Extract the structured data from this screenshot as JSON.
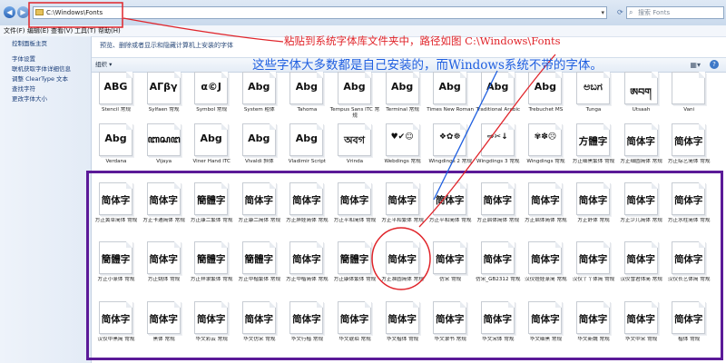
{
  "window": {
    "nav_back_icon": "back-arrow-icon",
    "nav_forward_icon": "forward-arrow-icon",
    "address": "C:\\Windows\\Fonts",
    "search_placeholder": "搜索 Fonts"
  },
  "menu": [
    "文件(F)",
    "编辑(E)",
    "查看(V)",
    "工具(T)",
    "帮助(H)"
  ],
  "sidebar": {
    "home": "控制面板主页",
    "links": [
      "字体设置",
      "联机获取字体详细信息",
      "调整 ClearType 文本",
      "查找字符",
      "更改字体大小"
    ]
  },
  "main": {
    "description": "预览、删除或者显示和隐藏计算机上安装的字体",
    "organize": "组织 ▾"
  },
  "annotations": {
    "red": "粘贴到系统字体库文件夹中，路径如图  C:\\Windows\\Fonts",
    "blue": "这些字体大多数都是自己安装的，而Windows系统不带的字体。",
    "colors": {
      "red": "#e0242a",
      "blue": "#1f5fe0",
      "frame": "#5b1a98"
    }
  },
  "rows": [
    [
      {
        "g": "ABG",
        "l": "Stencil 常规"
      },
      {
        "g": "AΓβγ",
        "l": "Sylfaen 常规"
      },
      {
        "g": "α©J",
        "l": "Symbol 常规"
      },
      {
        "g": "Abg",
        "l": "System 粗体"
      },
      {
        "g": "Abg",
        "l": "Tahoma"
      },
      {
        "g": "Abg",
        "l": "Tempus Sans ITC 常规"
      },
      {
        "g": "Abg",
        "l": "Terminal 常规"
      },
      {
        "g": "Abg",
        "l": "Times New Roman"
      },
      {
        "g": "Abg",
        "l": "Traditional Arabic"
      },
      {
        "g": "Abg",
        "l": "Trebuchet MS"
      },
      {
        "g": "ಅಬಗ",
        "l": "Tunga"
      },
      {
        "g": "ཨབག",
        "l": "Utsaah"
      },
      {
        "g": "",
        "l": "Vani"
      }
    ],
    [
      {
        "g": "Abg",
        "l": "Verdana"
      },
      {
        "g": "ꦧꦱꦔ",
        "l": "Vijaya"
      },
      {
        "g": "Abg",
        "l": "Viner Hand ITC"
      },
      {
        "g": "Abg",
        "l": "Vivaldi 斜体"
      },
      {
        "g": "Abg",
        "l": "Vladimir Script"
      },
      {
        "g": "অবগ",
        "l": "Vrinda"
      },
      {
        "g": "♥✔☺",
        "l": "Webdings 常规"
      },
      {
        "g": "❖✿☸",
        "l": "Wingdings 2 常规"
      },
      {
        "g": "⇨✂↓",
        "l": "Wingdings 3 常规"
      },
      {
        "g": "✾✽☹",
        "l": "Wingdings 常规"
      },
      {
        "g": "方體字",
        "l": "方正细黑繁体 常规"
      },
      {
        "g": "简体字",
        "l": "方正细圆简体 常规"
      },
      {
        "g": "简体字",
        "l": "方正综艺简体 常规"
      }
    ],
    [
      {
        "g": "简体字",
        "l": "方正黄草简体 常规"
      },
      {
        "g": "简体字",
        "l": "方正卡通简体 常规"
      },
      {
        "g": "簡體字",
        "l": "方正康二繁体 常规"
      },
      {
        "g": "简体字",
        "l": "方正康二简体 常规"
      },
      {
        "g": "简体字",
        "l": "方正胖娃简体 常规"
      },
      {
        "g": "简体字",
        "l": "方正平和简体 常规"
      },
      {
        "g": "简体字",
        "l": "方正平和繁体 常规"
      },
      {
        "g": "简体字",
        "l": "方正平和简体 常规"
      },
      {
        "g": "简体字",
        "l": "方正启体简体 常规"
      },
      {
        "g": "简体字",
        "l": "方正启体简体 常规"
      },
      {
        "g": "简体字",
        "l": "方正舒体 常规"
      },
      {
        "g": "简体字",
        "l": "方正少儿简体 常规"
      },
      {
        "g": "简体字",
        "l": "方正水柱简体 常规"
      }
    ],
    [
      {
        "g": "簡體字",
        "l": "方正小篆体 常规"
      },
      {
        "g": "简体字",
        "l": "方正姚体 常规"
      },
      {
        "g": "簡體字",
        "l": "方正祥隶繁体 常规"
      },
      {
        "g": "簡體字",
        "l": "方正中楷繁体 常规"
      },
      {
        "g": "简体字",
        "l": "方正中楷简体 常规"
      },
      {
        "g": "簡體字",
        "l": "方正康体繁体 常规"
      },
      {
        "g": "简体字",
        "l": "方正准圆简体 常规"
      },
      {
        "g": "简体字",
        "l": "仿宋 常规"
      },
      {
        "g": "简体字",
        "l": "仿宋_GB2312 常规"
      },
      {
        "g": "简体字",
        "l": "汉仪娃娃篆简 常规"
      },
      {
        "g": "简体字",
        "l": "汉仪丫丫体简 常规"
      },
      {
        "g": "简体字",
        "l": "汉仪雪君体简 常规"
      },
      {
        "g": "简体字",
        "l": "汉仪长艺体简 常规"
      }
    ],
    [
      {
        "g": "简体字",
        "l": "汉仪中黑简 常规"
      },
      {
        "g": "简体字",
        "l": "黑体 常规"
      },
      {
        "g": "简体字",
        "l": "华文彩云 常规"
      },
      {
        "g": "简体字",
        "l": "华文仿宋 常规"
      },
      {
        "g": "简体字",
        "l": "华文行楷 常规"
      },
      {
        "g": "简体字",
        "l": "华文琥珀 常规"
      },
      {
        "g": "简体字",
        "l": "华文楷体 常规"
      },
      {
        "g": "简体字",
        "l": "华文隶书 常规"
      },
      {
        "g": "简体字",
        "l": "华文宋体 常规"
      },
      {
        "g": "简体字",
        "l": "华文细黑 常规"
      },
      {
        "g": "简体字",
        "l": "华文新魏 常规"
      },
      {
        "g": "简体字",
        "l": "华文中宋 常规"
      },
      {
        "g": "简体字",
        "l": "楷体 常规"
      }
    ]
  ]
}
